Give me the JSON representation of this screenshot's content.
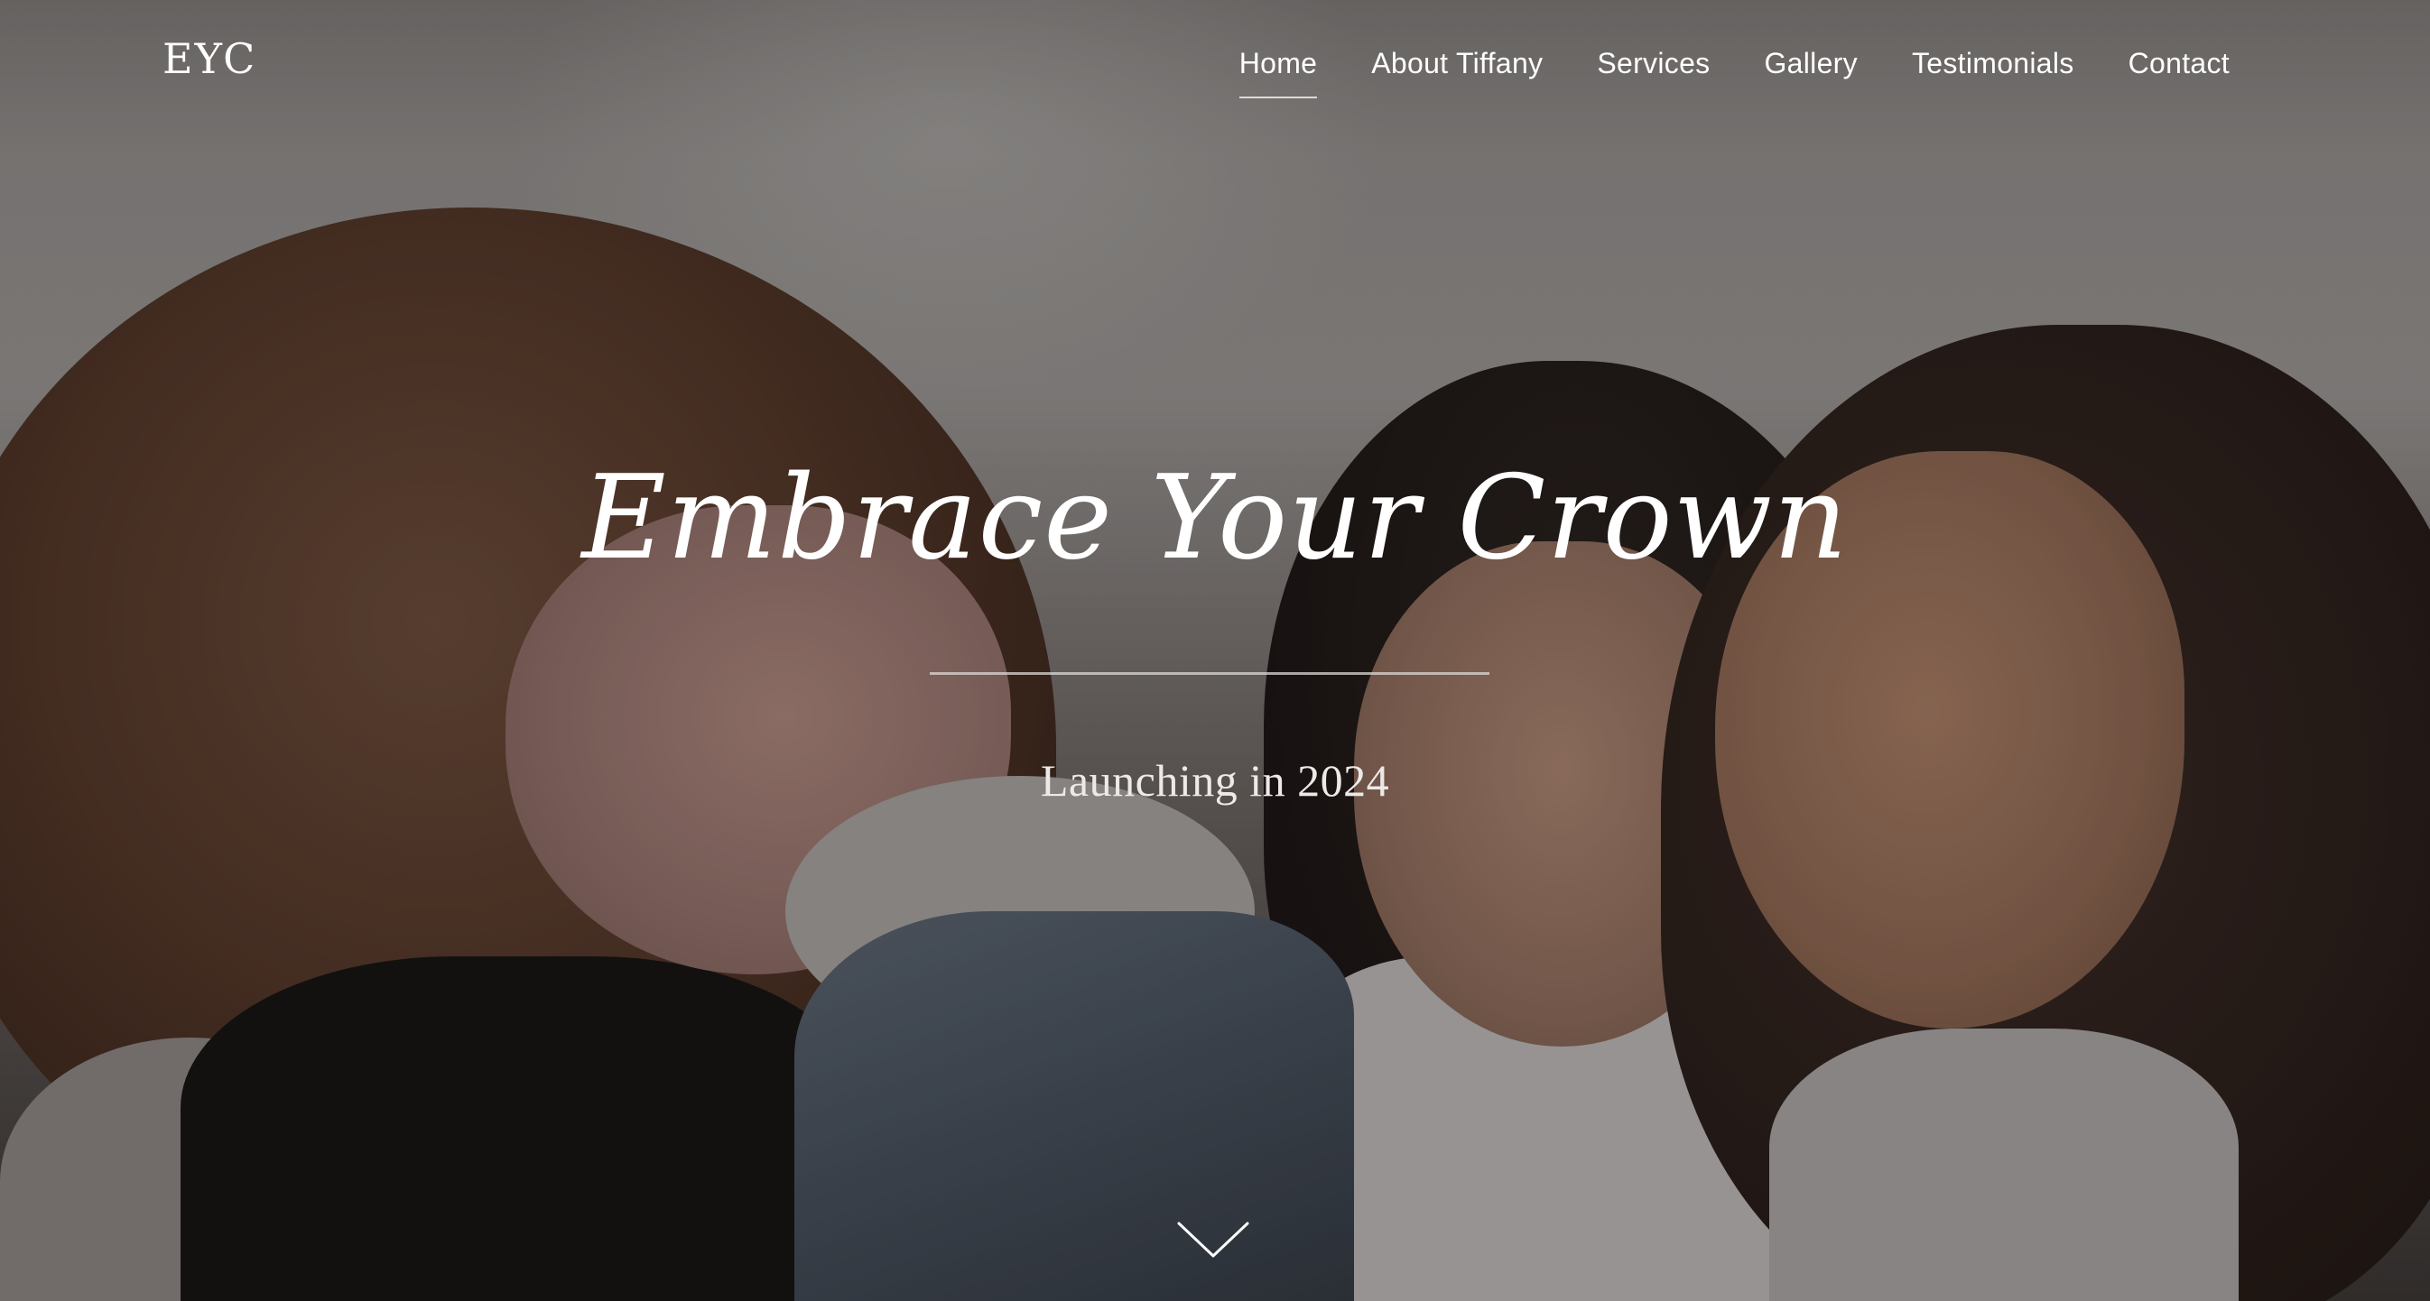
{
  "header": {
    "logo": "EYC",
    "nav": [
      {
        "label": "Home",
        "active": true
      },
      {
        "label": "About Tiffany",
        "active": false
      },
      {
        "label": "Services",
        "active": false
      },
      {
        "label": "Gallery",
        "active": false
      },
      {
        "label": "Testimonials",
        "active": false
      },
      {
        "label": "Contact",
        "active": false
      }
    ]
  },
  "hero": {
    "title": "Embrace Your Crown",
    "subtitle": "Launching in 2024",
    "scroll_icon": "chevron-down-icon"
  }
}
